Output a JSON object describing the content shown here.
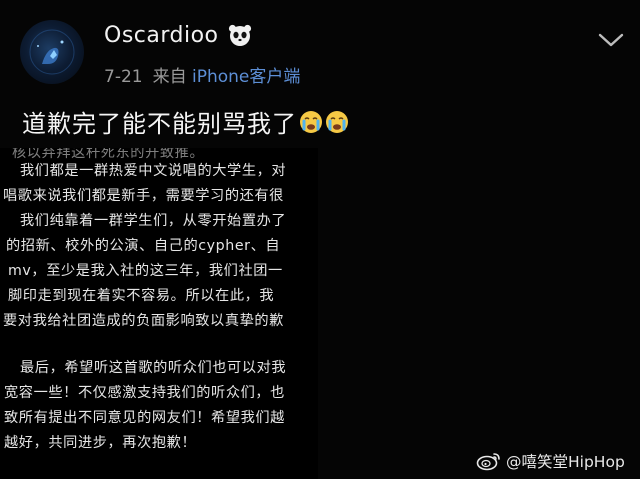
{
  "post": {
    "username": "Oscardioo",
    "date": "7-21",
    "source_prefix": "来自",
    "source_device": "iPhone客户端",
    "text": "道歉完了能不能别骂我了"
  },
  "image_text": {
    "lines": [
      "核以弃拜这杆死东的开致推。",
      "我们都是一群热爱中文说唱的大学生，对",
      "唱歌来说我们都是新手，需要学习的还有很",
      "我们纯靠着一群学生们，从零开始置办了",
      "的招新、校外的公演、自己的cypher、自",
      "mv，至少是我入社的这三年，我们社团一",
      "脚印走到现在着实不容易。所以在此，我",
      "要对我给社团造成的负面影响致以真挚的歉",
      "",
      "最后，希望听这首歌的听众们也可以对我",
      "宽容一些！不仅感激支持我们的听众们，也",
      "致所有提出不同意见的网友们！希望我们越",
      "越好，共同进步，再次抱歉！"
    ]
  },
  "watermark": {
    "text": "@嘻笑堂HipHop"
  },
  "icons": {
    "avatar": "avatar",
    "badge": "panda-icon",
    "menu": "chevron-down-icon",
    "emoji": "crying-emoji-icon",
    "watermark": "weibo-logo-icon"
  },
  "colors": {
    "background": "#050505",
    "source_link": "#5d8fd6",
    "meta_text": "#9a9a9a"
  }
}
